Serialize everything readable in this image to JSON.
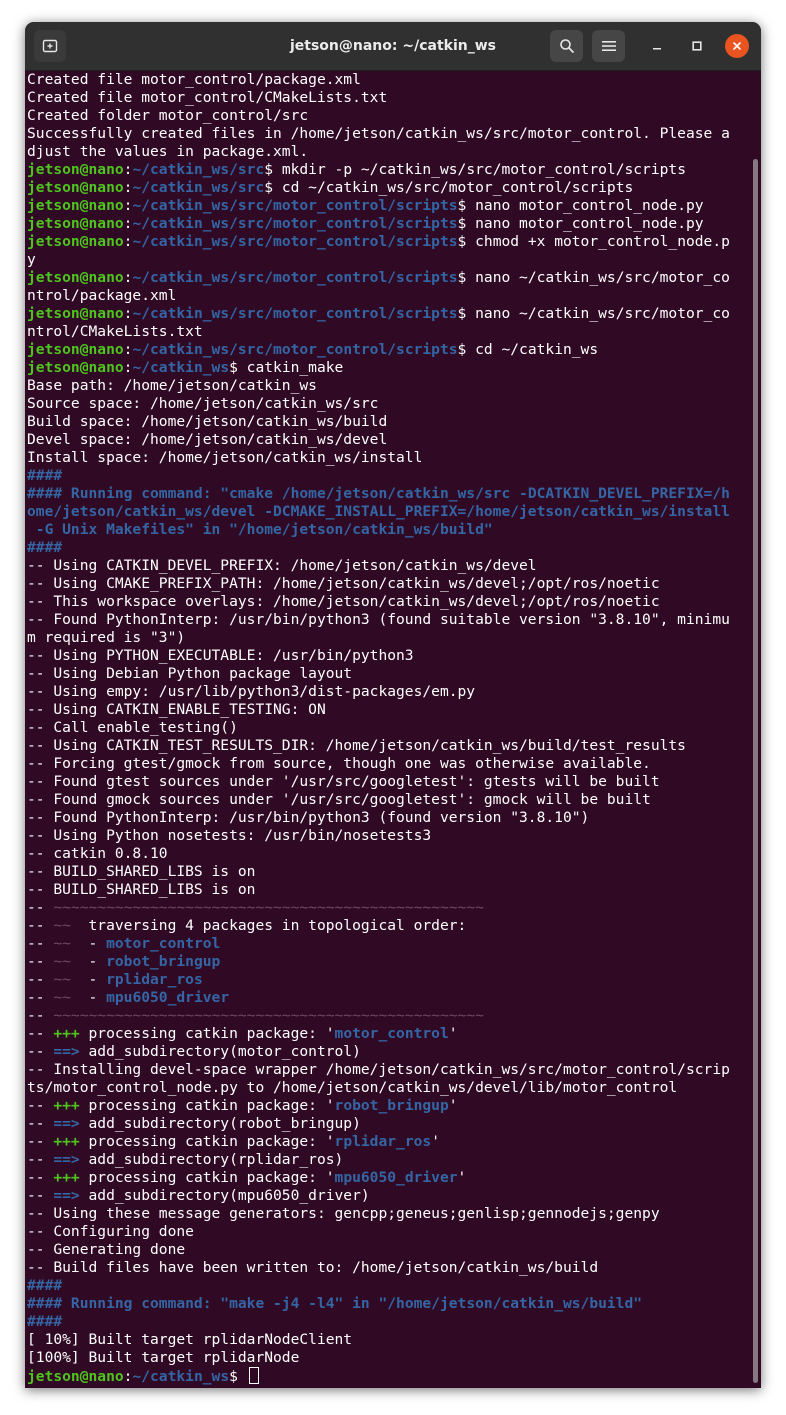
{
  "window": {
    "title": "jetson@nano: ~/catkin_ws",
    "controls": {
      "new_tab_icon": "new-tab-icon",
      "search_icon": "search-icon",
      "menu_icon": "hamburger-menu-icon",
      "minimize_icon": "minimize-icon",
      "maximize_icon": "maximize-icon",
      "close_icon": "close-icon"
    }
  },
  "colors": {
    "background": "#300a24",
    "prompt_user": "#4ec51e",
    "prompt_path": "#3465a4",
    "text": "#ffffff",
    "dim": "#6e4a66",
    "close_button": "#e95420",
    "titlebar": "#303030"
  },
  "terminal": {
    "lines": [
      [
        {
          "t": "Created file motor_control/package.xml"
        }
      ],
      [
        {
          "t": "Created file motor_control/CMakeLists.txt"
        }
      ],
      [
        {
          "t": "Created folder motor_control/src"
        }
      ],
      [
        {
          "t": "Successfully created files in /home/jetson/catkin_ws/src/motor_control. Please a"
        }
      ],
      [
        {
          "t": "djust the values in package.xml."
        }
      ],
      [
        {
          "t": "jetson@nano",
          "c": "g"
        },
        {
          "t": ":"
        },
        {
          "t": "~/catkin_ws/src",
          "c": "b"
        },
        {
          "t": "$ mkdir -p ~/catkin_ws/src/motor_control/scripts"
        }
      ],
      [
        {
          "t": "jetson@nano",
          "c": "g"
        },
        {
          "t": ":"
        },
        {
          "t": "~/catkin_ws/src",
          "c": "b"
        },
        {
          "t": "$ cd ~/catkin_ws/src/motor_control/scripts"
        }
      ],
      [
        {
          "t": "jetson@nano",
          "c": "g"
        },
        {
          "t": ":"
        },
        {
          "t": "~/catkin_ws/src/motor_control/scripts",
          "c": "b"
        },
        {
          "t": "$ nano motor_control_node.py"
        }
      ],
      [
        {
          "t": "jetson@nano",
          "c": "g"
        },
        {
          "t": ":"
        },
        {
          "t": "~/catkin_ws/src/motor_control/scripts",
          "c": "b"
        },
        {
          "t": "$ nano motor_control_node.py"
        }
      ],
      [
        {
          "t": "jetson@nano",
          "c": "g"
        },
        {
          "t": ":"
        },
        {
          "t": "~/catkin_ws/src/motor_control/scripts",
          "c": "b"
        },
        {
          "t": "$ chmod +x motor_control_node.p"
        }
      ],
      [
        {
          "t": "y"
        }
      ],
      [
        {
          "t": "jetson@nano",
          "c": "g"
        },
        {
          "t": ":"
        },
        {
          "t": "~/catkin_ws/src/motor_control/scripts",
          "c": "b"
        },
        {
          "t": "$ nano ~/catkin_ws/src/motor_co"
        }
      ],
      [
        {
          "t": "ntrol/package.xml"
        }
      ],
      [
        {
          "t": "jetson@nano",
          "c": "g"
        },
        {
          "t": ":"
        },
        {
          "t": "~/catkin_ws/src/motor_control/scripts",
          "c": "b"
        },
        {
          "t": "$ nano ~/catkin_ws/src/motor_co"
        }
      ],
      [
        {
          "t": "ntrol/CMakeLists.txt"
        }
      ],
      [
        {
          "t": "jetson@nano",
          "c": "g"
        },
        {
          "t": ":"
        },
        {
          "t": "~/catkin_ws/src/motor_control/scripts",
          "c": "b"
        },
        {
          "t": "$ cd ~/catkin_ws"
        }
      ],
      [
        {
          "t": "jetson@nano",
          "c": "g"
        },
        {
          "t": ":"
        },
        {
          "t": "~/catkin_ws",
          "c": "b"
        },
        {
          "t": "$ catkin_make"
        }
      ],
      [
        {
          "t": "Base path: /home/jetson/catkin_ws"
        }
      ],
      [
        {
          "t": "Source space: /home/jetson/catkin_ws/src"
        }
      ],
      [
        {
          "t": "Build space: /home/jetson/catkin_ws/build"
        }
      ],
      [
        {
          "t": "Devel space: /home/jetson/catkin_ws/devel"
        }
      ],
      [
        {
          "t": "Install space: /home/jetson/catkin_ws/install"
        }
      ],
      [
        {
          "t": "####",
          "c": "b"
        }
      ],
      [
        {
          "t": "#### Running command: ",
          "c": "b"
        },
        {
          "t": "\"cmake /home/jetson/catkin_ws/src -DCATKIN_DEVEL_PREFIX=/h",
          "c": "b"
        }
      ],
      [
        {
          "t": "ome/jetson/catkin_ws/devel -DCMAKE_INSTALL_PREFIX=/home/jetson/catkin_ws/install",
          "c": "b"
        }
      ],
      [
        {
          "t": " -G Unix Makefiles\"",
          "c": "b"
        },
        {
          "t": " in ",
          "c": "b"
        },
        {
          "t": "\"/home/jetson/catkin_ws/build\"",
          "c": "b"
        }
      ],
      [
        {
          "t": "####",
          "c": "b"
        }
      ],
      [
        {
          "t": "-- Using CATKIN_DEVEL_PREFIX: /home/jetson/catkin_ws/devel"
        }
      ],
      [
        {
          "t": "-- Using CMAKE_PREFIX_PATH: /home/jetson/catkin_ws/devel;/opt/ros/noetic"
        }
      ],
      [
        {
          "t": "-- This workspace overlays: /home/jetson/catkin_ws/devel;/opt/ros/noetic"
        }
      ],
      [
        {
          "t": "-- Found PythonInterp: /usr/bin/python3 (found suitable version \"3.8.10\", minimu"
        }
      ],
      [
        {
          "t": "m required is \"3\")"
        }
      ],
      [
        {
          "t": "-- Using PYTHON_EXECUTABLE: /usr/bin/python3"
        }
      ],
      [
        {
          "t": "-- Using Debian Python package layout"
        }
      ],
      [
        {
          "t": "-- Using empy: /usr/lib/python3/dist-packages/em.py"
        }
      ],
      [
        {
          "t": "-- Using CATKIN_ENABLE_TESTING: ON"
        }
      ],
      [
        {
          "t": "-- Call enable_testing()"
        }
      ],
      [
        {
          "t": "-- Using CATKIN_TEST_RESULTS_DIR: /home/jetson/catkin_ws/build/test_results"
        }
      ],
      [
        {
          "t": "-- Forcing gtest/gmock from source, though one was otherwise available."
        }
      ],
      [
        {
          "t": "-- Found gtest sources under '/usr/src/googletest': gtests will be built"
        }
      ],
      [
        {
          "t": "-- Found gmock sources under '/usr/src/googletest': gmock will be built"
        }
      ],
      [
        {
          "t": "-- Found PythonInterp: /usr/bin/python3 (found version \"3.8.10\")"
        }
      ],
      [
        {
          "t": "-- Using Python nosetests: /usr/bin/nosetests3"
        }
      ],
      [
        {
          "t": "-- catkin 0.8.10"
        }
      ],
      [
        {
          "t": "-- BUILD_SHARED_LIBS is on"
        }
      ],
      [
        {
          "t": "-- BUILD_SHARED_LIBS is on"
        }
      ],
      [
        {
          "t": "-- "
        },
        {
          "t": "~~~~~~~~~~~~~~~~~~~~~~~~~~~~~~~~~~~~~~~~~~~~~~~~~",
          "c": "m"
        }
      ],
      [
        {
          "t": "-- "
        },
        {
          "t": "~~",
          "c": "m"
        },
        {
          "t": "  traversing 4 packages in topological order:"
        }
      ],
      [
        {
          "t": "-- "
        },
        {
          "t": "~~",
          "c": "m"
        },
        {
          "t": "  - "
        },
        {
          "t": "motor_control",
          "c": "b"
        }
      ],
      [
        {
          "t": "-- "
        },
        {
          "t": "~~",
          "c": "m"
        },
        {
          "t": "  - "
        },
        {
          "t": "robot_bringup",
          "c": "b"
        }
      ],
      [
        {
          "t": "-- "
        },
        {
          "t": "~~",
          "c": "m"
        },
        {
          "t": "  - "
        },
        {
          "t": "rplidar_ros",
          "c": "b"
        }
      ],
      [
        {
          "t": "-- "
        },
        {
          "t": "~~",
          "c": "m"
        },
        {
          "t": "  - "
        },
        {
          "t": "mpu6050_driver",
          "c": "b"
        }
      ],
      [
        {
          "t": "-- "
        },
        {
          "t": "~~~~~~~~~~~~~~~~~~~~~~~~~~~~~~~~~~~~~~~~~~~~~~~~~",
          "c": "m"
        }
      ],
      [
        {
          "t": "-- "
        },
        {
          "t": "+++",
          "c": "g"
        },
        {
          "t": " processing catkin package: '"
        },
        {
          "t": "motor_control",
          "c": "b"
        },
        {
          "t": "'"
        }
      ],
      [
        {
          "t": "-- "
        },
        {
          "t": "==>",
          "c": "b"
        },
        {
          "t": " add_subdirectory(motor_control)"
        }
      ],
      [
        {
          "t": "-- Installing devel-space wrapper /home/jetson/catkin_ws/src/motor_control/scrip"
        }
      ],
      [
        {
          "t": "ts/motor_control_node.py to /home/jetson/catkin_ws/devel/lib/motor_control"
        }
      ],
      [
        {
          "t": "-- "
        },
        {
          "t": "+++",
          "c": "g"
        },
        {
          "t": " processing catkin package: '"
        },
        {
          "t": "robot_bringup",
          "c": "b"
        },
        {
          "t": "'"
        }
      ],
      [
        {
          "t": "-- "
        },
        {
          "t": "==>",
          "c": "b"
        },
        {
          "t": " add_subdirectory(robot_bringup)"
        }
      ],
      [
        {
          "t": "-- "
        },
        {
          "t": "+++",
          "c": "g"
        },
        {
          "t": " processing catkin package: '"
        },
        {
          "t": "rplidar_ros",
          "c": "b"
        },
        {
          "t": "'"
        }
      ],
      [
        {
          "t": "-- "
        },
        {
          "t": "==>",
          "c": "b"
        },
        {
          "t": " add_subdirectory(rplidar_ros)"
        }
      ],
      [
        {
          "t": "-- "
        },
        {
          "t": "+++",
          "c": "g"
        },
        {
          "t": " processing catkin package: '"
        },
        {
          "t": "mpu6050_driver",
          "c": "b"
        },
        {
          "t": "'"
        }
      ],
      [
        {
          "t": "-- "
        },
        {
          "t": "==>",
          "c": "b"
        },
        {
          "t": " add_subdirectory(mpu6050_driver)"
        }
      ],
      [
        {
          "t": "-- Using these message generators: gencpp;geneus;genlisp;gennodejs;genpy"
        }
      ],
      [
        {
          "t": "-- Configuring done"
        }
      ],
      [
        {
          "t": "-- Generating done"
        }
      ],
      [
        {
          "t": "-- Build files have been written to: /home/jetson/catkin_ws/build"
        }
      ],
      [
        {
          "t": "####",
          "c": "b"
        }
      ],
      [
        {
          "t": "#### Running command: ",
          "c": "b"
        },
        {
          "t": "\"make -j4 -l4\"",
          "c": "b"
        },
        {
          "t": " in ",
          "c": "b"
        },
        {
          "t": "\"/home/jetson/catkin_ws/build\"",
          "c": "b"
        }
      ],
      [
        {
          "t": "####",
          "c": "b"
        }
      ],
      [
        {
          "t": "[ 10%] Built target rplidarNodeClient"
        }
      ],
      [
        {
          "t": "[100%] Built target rplidarNode"
        }
      ],
      [
        {
          "t": "jetson@nano",
          "c": "g"
        },
        {
          "t": ":"
        },
        {
          "t": "~/catkin_ws",
          "c": "b"
        },
        {
          "t": "$ "
        }
      ]
    ]
  }
}
